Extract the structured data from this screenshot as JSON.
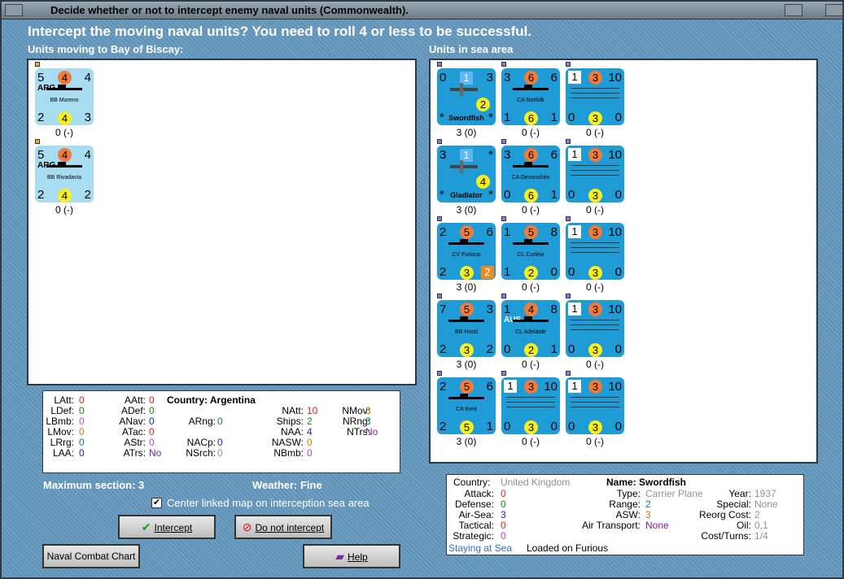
{
  "title": "Decide whether or not to intercept enemy naval units (Commonwealth).",
  "headline": "Intercept the moving naval units?  You need to roll 4 or less to be successful.",
  "left_label": "Units moving to Bay of Biscay:",
  "right_label": "Units in sea area",
  "moving_units": [
    {
      "tl": "5",
      "circ": "4",
      "tr": "4",
      "tag": "ARG",
      "name": "BB Moreno",
      "bl": "2",
      "ycirc": "4",
      "br": "3",
      "below": "0 (-)"
    },
    {
      "tl": "5",
      "circ": "4",
      "tr": "4",
      "tag": "ARG",
      "name": "BB Rivadavia",
      "bl": "2",
      "ycirc": "4",
      "br": "2",
      "below": "0 (-)"
    }
  ],
  "sea_units": [
    {
      "tl": "0",
      "sq": "1",
      "tr": "3",
      "name": "Swordfish",
      "plane": true,
      "ycirc": "2",
      "bl": "*",
      "br": "*",
      "below": "3 (0)"
    },
    {
      "tl": "3",
      "circ": "6",
      "tr": "6",
      "name": "CA Norfolk",
      "bl": "1",
      "ycirc": "6",
      "br": "1",
      "below": "0 (-)"
    },
    {
      "tl": "1",
      "circ": "3",
      "tr": "10",
      "convoy": true,
      "bl": "0",
      "ycirc": "3",
      "br": "0",
      "below": "0 (-)"
    },
    {
      "tl": "3",
      "sq": "1",
      "tr": "*",
      "name": "Gladiator",
      "plane": true,
      "ycirc": "4",
      "bl": "*",
      "br": "*",
      "below": "3 (0)"
    },
    {
      "tl": "3",
      "circ": "6",
      "tr": "6",
      "name": "CA Devonshire",
      "bl": "0",
      "ycirc": "6",
      "br": "1",
      "below": "0 (-)"
    },
    {
      "tl": "1",
      "circ": "3",
      "tr": "10",
      "convoy": true,
      "bl": "0",
      "ycirc": "3",
      "br": "0",
      "below": "0 (-)"
    },
    {
      "tl": "2",
      "circ": "5",
      "tr": "6",
      "name": "CV Furious",
      "bl": "2",
      "ycirc": "3",
      "br": "",
      "osq": "2",
      "below": "3 (0)"
    },
    {
      "tl": "1",
      "circ": "5",
      "tr": "8",
      "name": "CL Curlew",
      "bl": "1",
      "ycirc": "2",
      "br": "0",
      "below": "0 (-)"
    },
    {
      "tl": "1",
      "circ": "3",
      "tr": "10",
      "convoy": true,
      "bl": "0",
      "ycirc": "3",
      "br": "0",
      "below": "0 (-)"
    },
    {
      "tl": "7",
      "circ": "5",
      "tr": "3",
      "name": "BB Hood",
      "bl": "2",
      "ycirc": "3",
      "br": "2",
      "below": "3 (0)"
    },
    {
      "tl": "1",
      "circ": "4",
      "tr": "8",
      "tag": "AUS",
      "name": "CL Adelaide",
      "bl": "0",
      "ycirc": "2",
      "br": "1",
      "below": "0 (-)"
    },
    {
      "tl": "1",
      "circ": "3",
      "tr": "10",
      "convoy": true,
      "bl": "0",
      "ycirc": "3",
      "br": "0",
      "below": "0 (-)"
    },
    {
      "tl": "2",
      "circ": "5",
      "tr": "6",
      "name": "CA Kent",
      "bl": "2",
      "ycirc": "5",
      "br": "1",
      "below": "3 (0)"
    },
    {
      "tl": "1",
      "circ": "3",
      "tr": "10",
      "convoy": true,
      "bl": "0",
      "ycirc": "3",
      "br": "0",
      "below": "0 (-)"
    },
    {
      "tl": "1",
      "circ": "3",
      "tr": "10",
      "convoy": true,
      "bl": "0",
      "ycirc": "3",
      "br": "0",
      "below": "0 (-)"
    }
  ],
  "country_stats": {
    "country_label": "Country: Argentina",
    "items": [
      {
        "k": "LAtt:",
        "v": "0",
        "c": "#e02020"
      },
      {
        "k": "LDef:",
        "v": "0",
        "c": "#109010"
      },
      {
        "k": "LBmb:",
        "v": "0",
        "c": "#c040c0"
      },
      {
        "k": "LMov:",
        "v": "0",
        "c": "#c08000"
      },
      {
        "k": "LRrg:",
        "v": "0",
        "c": "#108080"
      },
      {
        "k": "LAA:",
        "v": "0",
        "c": "#2020d0"
      },
      {
        "k": "AAtt:",
        "v": "0",
        "c": "#e02020"
      },
      {
        "k": "ADef:",
        "v": "0",
        "c": "#109010"
      },
      {
        "k": "ANav:",
        "v": "0",
        "c": "#2020d0"
      },
      {
        "k": "ATac:",
        "v": "0",
        "c": "#e02020"
      },
      {
        "k": "AStr:",
        "v": "0",
        "c": "#c040c0"
      },
      {
        "k": "ATrs:",
        "v": "No",
        "c": "#8020a0"
      },
      {
        "k": "ARng:",
        "v": "0",
        "c": "#108080"
      },
      {
        "k": "NACp:",
        "v": "0",
        "c": "#2020d0"
      },
      {
        "k": "NSrch:",
        "v": "0",
        "c": "#909090"
      },
      {
        "k": "NAtt:",
        "v": "10",
        "c": "#e02020"
      },
      {
        "k": "Ships:",
        "v": "2",
        "c": "#109010"
      },
      {
        "k": "NAA:",
        "v": "4",
        "c": "#2020d0"
      },
      {
        "k": "NASW:",
        "v": "0",
        "c": "#d08000"
      },
      {
        "k": "NBmb:",
        "v": "0",
        "c": "#c040c0"
      },
      {
        "k": "NMov:",
        "v": "3",
        "c": "#c08000"
      },
      {
        "k": "NRng:",
        "v": "3",
        "c": "#108080"
      },
      {
        "k": "NTrs:",
        "v": "No",
        "c": "#8020a0"
      }
    ]
  },
  "max_section": "Maximum section: 3",
  "weather": "Weather:  Fine",
  "center_map_label": "Center linked map on interception sea area",
  "buttons": {
    "intercept": "Intercept",
    "do_not_intercept": "Do not intercept",
    "naval_combat_chart": "Naval Combat Chart",
    "help": "Help"
  },
  "unit_info": {
    "country_k": "Country:",
    "country_v": "United Kingdom",
    "name_v": "Name: Swordfish",
    "attack_k": "Attack:",
    "attack_v": "0",
    "defense_k": "Defense:",
    "defense_v": "0",
    "airsea_k": "Air-Sea:",
    "airsea_v": "3",
    "tactical_k": "Tactical:",
    "tactical_v": "0",
    "strategic_k": "Strategic:",
    "strategic_v": "0",
    "type_k": "Type:",
    "type_v": "Carrier Plane",
    "range_k": "Range:",
    "range_v": "2",
    "asw_k": "ASW:",
    "asw_v": "3",
    "airtrans_k": "Air Transport:",
    "airtrans_v": "None",
    "year_k": "Year:",
    "year_v": "1937",
    "special_k": "Special:",
    "special_v": "None",
    "reorg_k": "Reorg Cost:",
    "reorg_v": "2",
    "oil_k": "Oil:",
    "oil_v": "0,1",
    "cost_k": "Cost/Turns:",
    "cost_v": "1/4",
    "staying": "Staying at Sea",
    "loaded": "Loaded on Furious"
  }
}
